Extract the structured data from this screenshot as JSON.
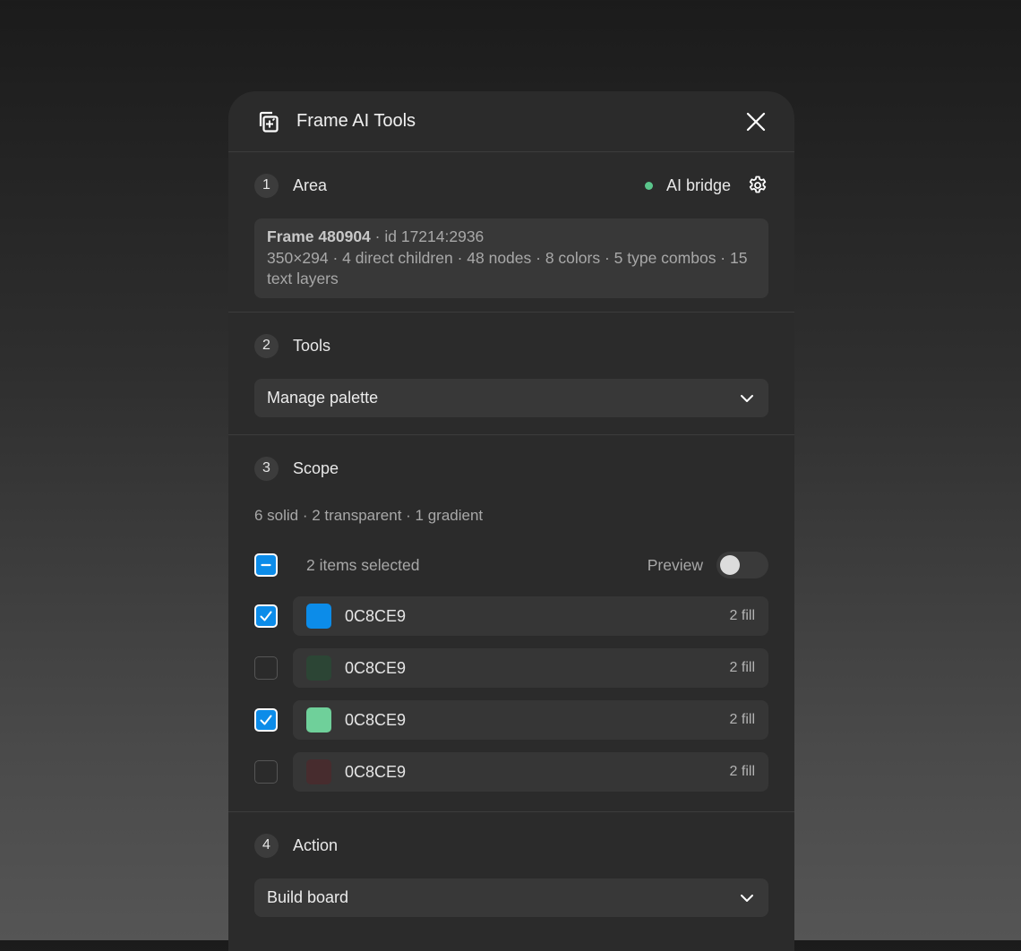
{
  "panel": {
    "title": "Frame AI Tools",
    "icon": "frame-ai-icon",
    "close_icon": "close-icon"
  },
  "area": {
    "step": "1",
    "label": "Area",
    "bridge_label": "AI bridge",
    "bridge_status_color": "#5ac58b",
    "settings_icon": "gear-icon",
    "frame_name": "Frame 480904",
    "frame_id": " ·  id 17214:2936",
    "frame_stats": "350×294 · 4 direct children · 48 nodes · 8 colors · 5 type combos · 15 text layers"
  },
  "tools": {
    "step": "2",
    "label": "Tools",
    "selected": "Manage palette"
  },
  "scope": {
    "step": "3",
    "label": "Scope",
    "summary": "6 solid · 2 transparent · 1 gradient",
    "selection_text": "2 items selected",
    "preview_label": "Preview",
    "preview_on": false,
    "colors": [
      {
        "hex": "0C8CE9",
        "swatch": "#0c8ce9",
        "count": "2 fill",
        "checked": true
      },
      {
        "hex": "0C8CE9",
        "swatch": "#2c4535",
        "count": "2 fill",
        "checked": false
      },
      {
        "hex": "0C8CE9",
        "swatch": "#6fd09a",
        "count": "2 fill",
        "checked": true
      },
      {
        "hex": "0C8CE9",
        "swatch": "#472c2e",
        "count": "2 fill",
        "checked": false
      }
    ]
  },
  "action": {
    "step": "4",
    "label": "Action",
    "selected": "Build board"
  },
  "colors": {
    "accent": "#0c8ce9",
    "panel_bg": "#2b2b2b",
    "card_bg": "#383838"
  }
}
